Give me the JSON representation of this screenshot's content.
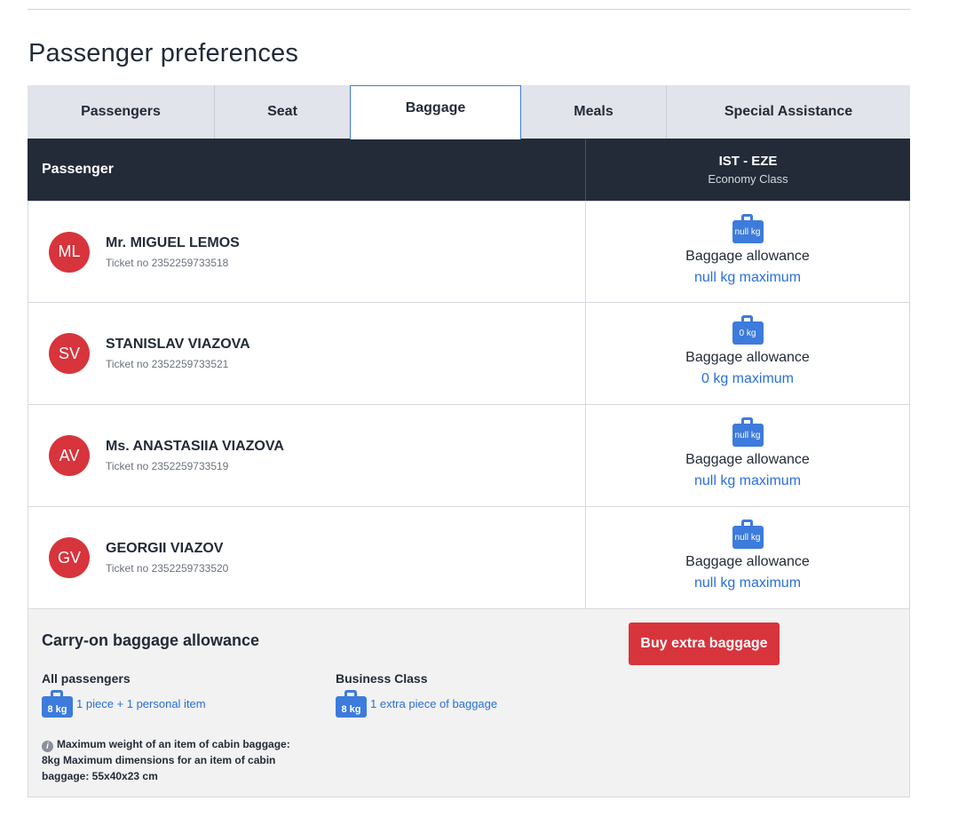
{
  "page": {
    "title": "Passenger preferences"
  },
  "tabs": [
    {
      "label": "Passengers",
      "active": false
    },
    {
      "label": "Seat",
      "active": false
    },
    {
      "label": "Baggage",
      "active": true
    },
    {
      "label": "Meals",
      "active": false
    },
    {
      "label": "Special Assistance",
      "active": false
    }
  ],
  "table": {
    "passenger_header": "Passenger",
    "route": "IST - EZE",
    "cabin_class": "Economy Class",
    "allowance_label": "Baggage allowance"
  },
  "passengers": [
    {
      "initials": "ML",
      "name": "Mr. MIGUEL LEMOS",
      "ticket": "Ticket no 2352259733518",
      "bag_weight": "null kg",
      "allowance": "null kg maximum"
    },
    {
      "initials": "SV",
      "name": "STANISLAV VIAZOVA",
      "ticket": "Ticket no 2352259733521",
      "bag_weight": "0 kg",
      "allowance": "0 kg maximum"
    },
    {
      "initials": "AV",
      "name": "Ms. ANASTASIIA VIAZOVA",
      "ticket": "Ticket no 2352259733519",
      "bag_weight": "null kg",
      "allowance": "null kg maximum"
    },
    {
      "initials": "GV",
      "name": "GEORGII VIAZOV",
      "ticket": "Ticket no 2352259733520",
      "bag_weight": "null kg",
      "allowance": "null kg maximum"
    }
  ],
  "carry_on": {
    "title": "Carry-on baggage allowance",
    "buy_button": "Buy extra baggage",
    "all_passengers": {
      "title": "All passengers",
      "bag_weight": "8 kg",
      "text": "1 piece + 1 personal item"
    },
    "business_class": {
      "title": "Business Class",
      "bag_weight": "8 kg",
      "text": "1 extra piece of baggage"
    },
    "note": "Maximum weight of an item of cabin baggage: 8kg Maximum dimensions for an item of cabin baggage: 55x40x23 cm",
    "info_icon_glyph": "i"
  },
  "colors": {
    "accent_blue": "#3d7bdc",
    "link_blue": "#2a6fdb",
    "brand_red": "#d7343c",
    "header_dark": "#232b38",
    "tab_bg": "#e1e4ea"
  }
}
